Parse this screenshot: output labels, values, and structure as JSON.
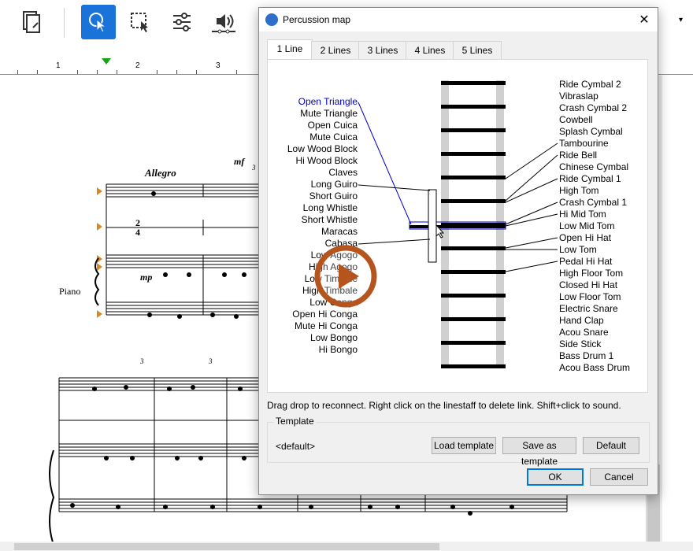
{
  "toolbar": {
    "icons": [
      "document-icon",
      "select-cursor-icon",
      "marquee-select-icon",
      "sliders-icon",
      "speaker-icon"
    ]
  },
  "ruler": {
    "numbers": [
      "1",
      "2",
      "3"
    ]
  },
  "score": {
    "tempo": "Allegro",
    "dynamic1": "mf",
    "dynamic2": "mp",
    "instrument": "Piano",
    "time_top": "2",
    "time_bottom": "4",
    "triplet": "3"
  },
  "dialog": {
    "title": "Percussion map",
    "close_glyph": "✕",
    "tabs": [
      "1 Line",
      "2 Lines",
      "3 Lines",
      "4 Lines",
      "5 Lines"
    ],
    "active_tab": "1 Line",
    "left_instruments": [
      "Open Triangle",
      "Mute Triangle",
      "Open Cuica",
      "Mute Cuica",
      "Low Wood Block",
      "Hi Wood Block",
      "Claves",
      "Long Guiro",
      "Short Guiro",
      "Long Whistle",
      "Short Whistle",
      "Maracas",
      "Cabasa",
      "Low Agogo",
      "High Agogo",
      "Low Timbale",
      "High Timbale",
      "Low Conga",
      "Open Hi Conga",
      "Mute Hi Conga",
      "Low Bongo",
      "Hi Bongo"
    ],
    "selected_left": "Open Triangle",
    "right_instruments": [
      "Ride Cymbal 2",
      "Vibraslap",
      "Crash Cymbal 2",
      "Cowbell",
      "Splash Cymbal",
      "Tambourine",
      "Ride Bell",
      "Chinese Cymbal",
      "Ride Cymbal 1",
      "High Tom",
      "Crash Cymbal 1",
      "Hi Mid Tom",
      "Low Mid Tom",
      "Open Hi Hat",
      "Low Tom",
      "Pedal Hi Hat",
      "High Floor Tom",
      "Closed Hi Hat",
      "Low Floor Tom",
      "Electric Snare",
      "Hand Clap",
      "Acou Snare",
      "Side Stick",
      "Bass Drum 1",
      "Acou Bass Drum"
    ],
    "hint": "Drag  drop to reconnect. Right click on the linestaff to delete link. Shift+click to sound.",
    "template": {
      "label": "Template",
      "value": "<default>",
      "load_label": "Load template",
      "save_label": "Save as template",
      "default_label": "Default"
    },
    "ok_label": "OK",
    "cancel_label": "Cancel"
  },
  "colors": {
    "accent": "#1a73d9",
    "selected_text": "#0000cc",
    "play_overlay": "#b5541c",
    "marker": "#17a317"
  }
}
